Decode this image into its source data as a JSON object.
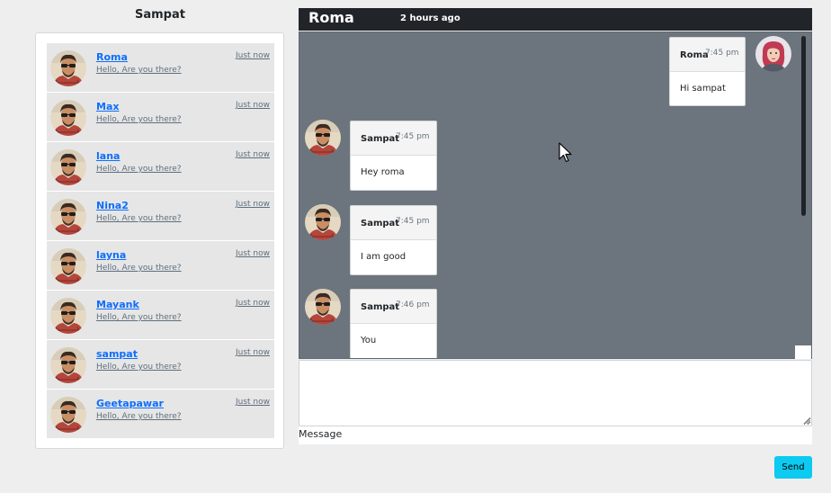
{
  "sidebar": {
    "title": "Sampat",
    "contacts": [
      {
        "name": "Roma",
        "preview": "Hello, Are you there?",
        "time": "Just now"
      },
      {
        "name": "Max",
        "preview": "Hello, Are you there?",
        "time": "Just now"
      },
      {
        "name": "lana",
        "preview": "Hello, Are you there?",
        "time": "Just now"
      },
      {
        "name": "Nina2",
        "preview": "Hello, Are you there?",
        "time": "Just now"
      },
      {
        "name": "layna",
        "preview": "Hello, Are you there?",
        "time": "Just now"
      },
      {
        "name": "Mayank",
        "preview": "Hello, Are you there?",
        "time": "Just now"
      },
      {
        "name": "sampat",
        "preview": "Hello, Are you there?",
        "time": "Just now"
      },
      {
        "name": "Geetapawar",
        "preview": "Hello, Are you there?",
        "time": "Just now"
      }
    ]
  },
  "chat": {
    "header": {
      "title": "Roma",
      "status": "2 hours ago"
    },
    "messages": [
      {
        "sender": "Roma",
        "time": "7:45 pm",
        "text": "Hi sampat"
      },
      {
        "sender": "Sampat",
        "time": "7:45 pm",
        "text": "Hey roma"
      },
      {
        "sender": "Sampat",
        "time": "7:45 pm",
        "text": "I am good"
      },
      {
        "sender": "Sampat",
        "time": "7:46 pm",
        "text": "You"
      }
    ]
  },
  "composer": {
    "label": "Message",
    "send_label": "Send"
  },
  "icons": {
    "avatar": "avatar-icon",
    "cursor": "mouse-pointer-icon",
    "resize": "resize-grip-icon"
  },
  "colors": {
    "header_bg": "#212529",
    "chat_bg": "#6c757d",
    "link": "#0d6efd",
    "send": "#0dcaf0"
  }
}
